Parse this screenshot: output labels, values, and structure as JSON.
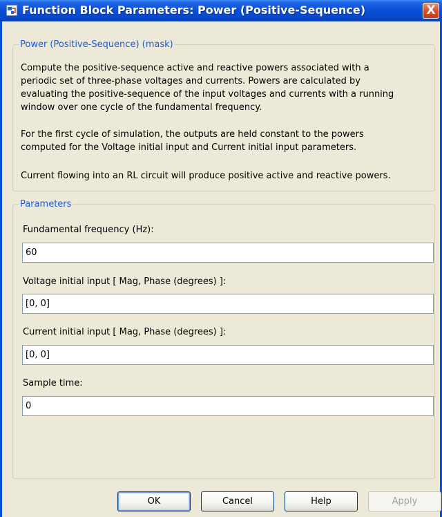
{
  "window": {
    "title": "Function Block Parameters: Power (Positive-Sequence)",
    "close_glyph": "X"
  },
  "mask": {
    "legend": "Power (Positive-Sequence) (mask)",
    "description_lines": [
      "Compute the positive-sequence active and reactive powers associated with a",
      "periodic set of three-phase voltages and currents. Powers are calculated by",
      "evaluating the positive-sequence of the input voltages and currents with a running",
      "window over one cycle of the fundamental frequency."
    ],
    "initial_note_lines": [
      "For the first cycle of simulation, the outputs are held constant to the powers",
      "computed for the Voltage initial input and Current initial input parameters."
    ],
    "rl_note": "Current flowing into an RL circuit will produce positive active and reactive powers."
  },
  "parameters": {
    "legend": "Parameters",
    "fields": [
      {
        "label": "Fundamental frequency (Hz):",
        "value": "60"
      },
      {
        "label": "Voltage initial input [ Mag,  Phase (degrees) ]:",
        "value": "[0, 0]"
      },
      {
        "label": "Current initial input [ Mag,  Phase (degrees) ]:",
        "value": "[0, 0]"
      },
      {
        "label": "Sample time:",
        "value": "0"
      }
    ]
  },
  "buttons": {
    "ok": "OK",
    "cancel": "Cancel",
    "help": "Help",
    "apply": "Apply"
  },
  "icons": {
    "title_icon": "block-parameters-icon",
    "close_icon": "close-icon"
  }
}
